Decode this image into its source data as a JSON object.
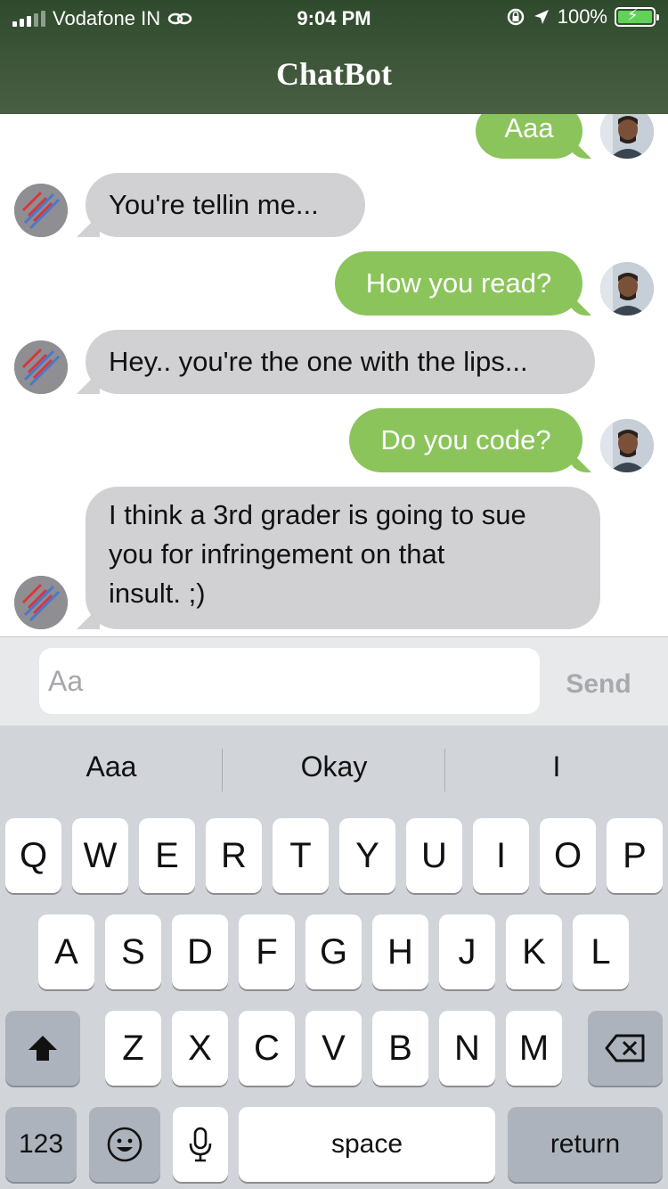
{
  "status_bar": {
    "carrier": "Vodafone IN",
    "time": "9:04 PM",
    "battery": "100%"
  },
  "nav": {
    "title": "ChatBot"
  },
  "messages": [
    {
      "sender": "user",
      "text": "Aaa"
    },
    {
      "sender": "bot",
      "text": "You're tellin me..."
    },
    {
      "sender": "user",
      "text": "How you read?"
    },
    {
      "sender": "bot",
      "text": "Hey.. you're the one with the lips..."
    },
    {
      "sender": "user",
      "text": "Do you code?"
    },
    {
      "sender": "bot",
      "line1": "I think a 3rd grader is going to sue",
      "line2": "you for infringement on that",
      "line3": "insult. ;)"
    }
  ],
  "composer": {
    "placeholder": "Aa",
    "value": "",
    "send_label": "Send"
  },
  "keyboard": {
    "suggestions": [
      "Aaa",
      "Okay",
      "I"
    ],
    "row1": [
      "Q",
      "W",
      "E",
      "R",
      "T",
      "Y",
      "U",
      "I",
      "O",
      "P"
    ],
    "row2": [
      "A",
      "S",
      "D",
      "F",
      "G",
      "H",
      "J",
      "K",
      "L"
    ],
    "row3": [
      "Z",
      "X",
      "C",
      "V",
      "B",
      "N",
      "M"
    ],
    "numbers_label": "123",
    "space_label": "space",
    "return_label": "return"
  },
  "colors": {
    "header": "#3b5436",
    "user_bubble": "#8bc45b",
    "bot_bubble": "#d1d1d3"
  }
}
